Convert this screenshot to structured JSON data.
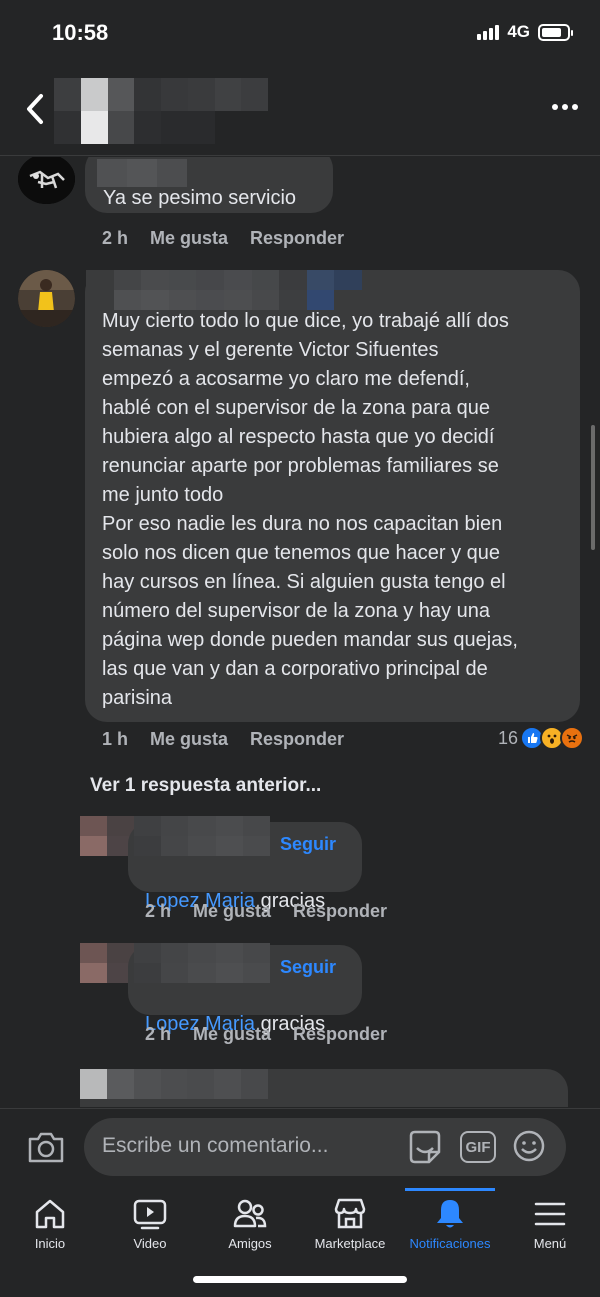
{
  "status_bar": {
    "time": "10:58",
    "network": "4G",
    "battery_level": 0.8
  },
  "header": {
    "back_icon": "chevron-left-icon",
    "more_icon": "more-horizontal-icon"
  },
  "comments": [
    {
      "text": "Ya se pesimo servicio",
      "time": "2 h",
      "like_label": "Me gusta",
      "reply_label": "Responder"
    },
    {
      "text": "Muy cierto todo lo que dice, yo trabajé allí dos\nsemanas y el gerente Victor Sifuentes\nempezó a acosarme yo claro me defendí,\nhablé con el supervisor de la zona para que\nhubiera algo al respecto hasta que yo decidí\nrenunciar aparte por problemas familiares se\nme junto todo\nPor eso nadie les dura no nos capacitan bien\nsolo nos dicen que tenemos que hacer y que\nhay cursos en línea. Si alguien gusta tengo el\nnúmero del supervisor de la zona y hay una\npágina wep donde pueden mandar sus quejas,\nlas que van y dan a corporativo principal de\nparisina",
      "time": "1 h",
      "like_label": "Me gusta",
      "reply_label": "Responder",
      "reaction_count": "16",
      "reactions": [
        "like-icon",
        "wow-icon",
        "angry-icon"
      ],
      "colors": {
        "like": "#1877f2",
        "wow": "#f7b125",
        "angry": "#e9710f"
      }
    }
  ],
  "view_more_replies": "Ver 1 respuesta anterior...",
  "replies": [
    {
      "follow_label": "Seguir",
      "mention": "Lopez Maria",
      "text": " gracias",
      "time": "2 h",
      "like_label": "Me gusta",
      "reply_label": "Responder"
    },
    {
      "follow_label": "Seguir",
      "mention": "Lopez Maria",
      "text": " gracias",
      "time": "2 h",
      "like_label": "Me gusta",
      "reply_label": "Responder"
    }
  ],
  "composer": {
    "placeholder": "Escribe un comentario...",
    "gif_label": "GIF"
  },
  "tabs": [
    {
      "label": "Inicio",
      "icon": "home-icon"
    },
    {
      "label": "Video",
      "icon": "video-icon"
    },
    {
      "label": "Amigos",
      "icon": "friends-icon"
    },
    {
      "label": "Marketplace",
      "icon": "marketplace-icon"
    },
    {
      "label": "Notificaciones",
      "icon": "bell-icon",
      "active": true
    },
    {
      "label": "Menú",
      "icon": "menu-icon"
    }
  ],
  "accent_color": "#2d88ff"
}
